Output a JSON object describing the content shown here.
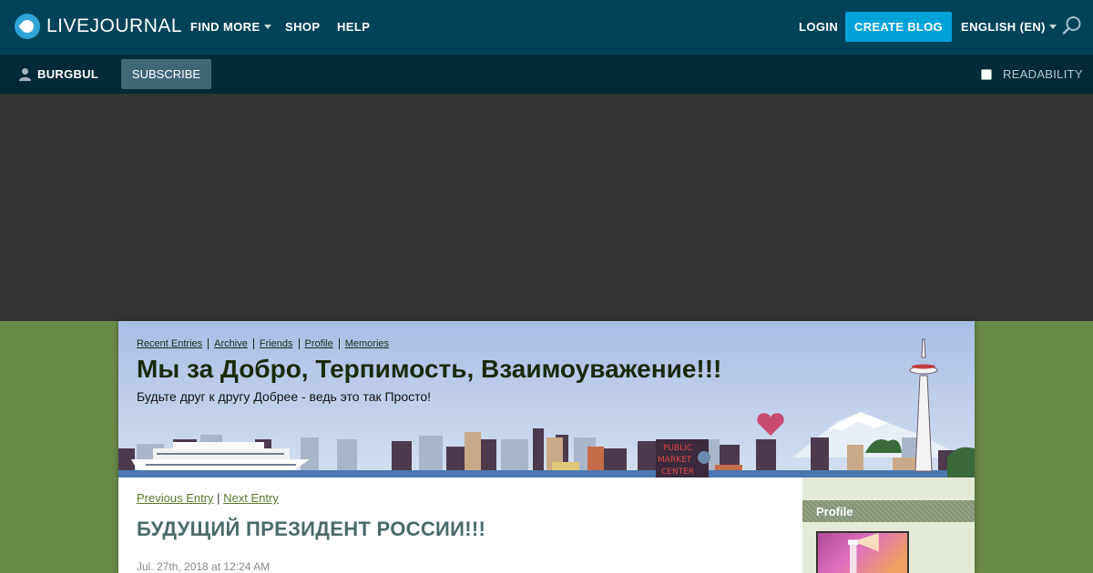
{
  "topbar": {
    "logo_text": "LIVEJOURNAL",
    "find_more": "FIND MORE",
    "shop": "SHOP",
    "help": "HELP",
    "login": "LOGIN",
    "create_blog": "CREATE BLOG",
    "language": "ENGLISH (EN)"
  },
  "subbar": {
    "username": "BURGBUL",
    "subscribe": "SUBSCRIBE",
    "readability": "READABILITY"
  },
  "journal": {
    "links": [
      "Recent Entries",
      "Archive",
      "Friends",
      "Profile",
      "Memories"
    ],
    "title": "Мы за Добро, Терпимость, Взаимоуважение!!!",
    "subtitle": "Будьте друг к другу Добрее - ведь это так Просто!",
    "prev_entry": "Previous Entry",
    "next_entry": "Next Entry",
    "nav_separator": "|",
    "entry_title": "БУДУЩИЙ ПРЕЗИДЕНТ РОССИИ!!!",
    "entry_date": "Jul. 27th, 2018 at 12:24 AM",
    "sidebar_profile": "Profile"
  },
  "colors": {
    "topbar": "#004359",
    "subbar": "#002a3a",
    "accent": "#00a3d9",
    "page_bg": "#6a8a48"
  }
}
